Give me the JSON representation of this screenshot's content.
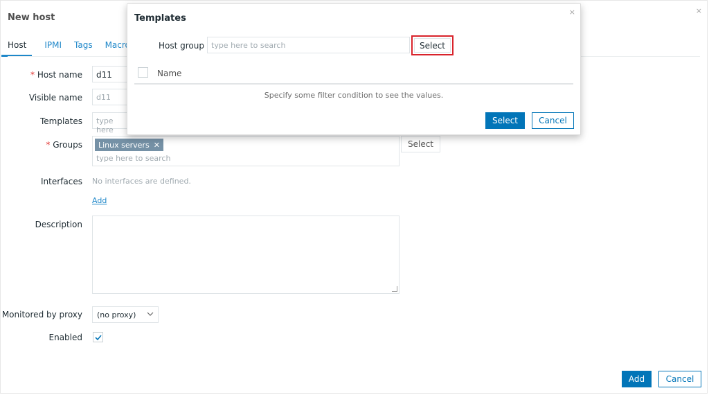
{
  "base_dialog": {
    "title": "New host",
    "close": "×",
    "tabs": [
      "Host",
      "IPMI",
      "Tags",
      "Macro"
    ],
    "form": {
      "host_name": {
        "label": "Host name",
        "required": "*",
        "value": "d11"
      },
      "visible_name": {
        "label": "Visible name",
        "placeholder": "d11"
      },
      "templates": {
        "label": "Templates",
        "placeholder": "type here"
      },
      "groups": {
        "label": "Groups",
        "required": "*",
        "chip": "Linux servers",
        "chip_remove": "✕",
        "placeholder": "type here to search",
        "select_label": "Select"
      },
      "interfaces": {
        "label": "Interfaces",
        "empty_text": "No interfaces are defined.",
        "add_link": "Add"
      },
      "description": {
        "label": "Description"
      },
      "proxy": {
        "label": "Monitored by proxy",
        "value": "(no proxy)"
      },
      "enabled": {
        "label": "Enabled",
        "checked": true
      }
    },
    "footer": {
      "add_label": "Add",
      "cancel_label": "Cancel"
    }
  },
  "templates_dialog": {
    "title": "Templates",
    "close": "×",
    "host_group_label": "Host group",
    "host_group_placeholder": "type here to search",
    "select_label": "Select",
    "column_name": "Name",
    "empty_message": "Specify some filter condition to see the values.",
    "footer": {
      "select_label": "Select",
      "cancel_label": "Cancel"
    }
  },
  "colors": {
    "accent": "#0275b8",
    "link": "#1e87c9",
    "highlight": "#d9232b",
    "chip": "#7591a6"
  }
}
